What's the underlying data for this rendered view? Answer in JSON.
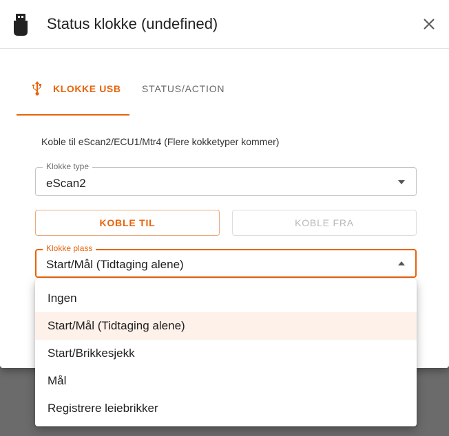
{
  "dialog": {
    "title": "Status klokke (undefined)",
    "accent_color": "#e8630a"
  },
  "tabs": [
    {
      "label": "KLOKKE USB",
      "icon": "usb-icon",
      "active": true
    },
    {
      "label": "STATUS/ACTION",
      "active": false
    }
  ],
  "description": "Koble til eScan2/ECU1/Mtr4 (Flere kokketyper kommer)",
  "clock_type": {
    "label": "Klokke type",
    "value": "eScan2"
  },
  "buttons": {
    "connect": "KOBLE TIL",
    "disconnect": "KOBLE FRA"
  },
  "clock_place": {
    "label": "Klokke plass",
    "value": "Start/Mål (Tidtaging alene)",
    "options": [
      "Ingen",
      "Start/Mål (Tidtaging alene)",
      "Start/Brikkesjekk",
      "Mål",
      "Registrere leiebrikker"
    ],
    "selected_index": 1
  }
}
